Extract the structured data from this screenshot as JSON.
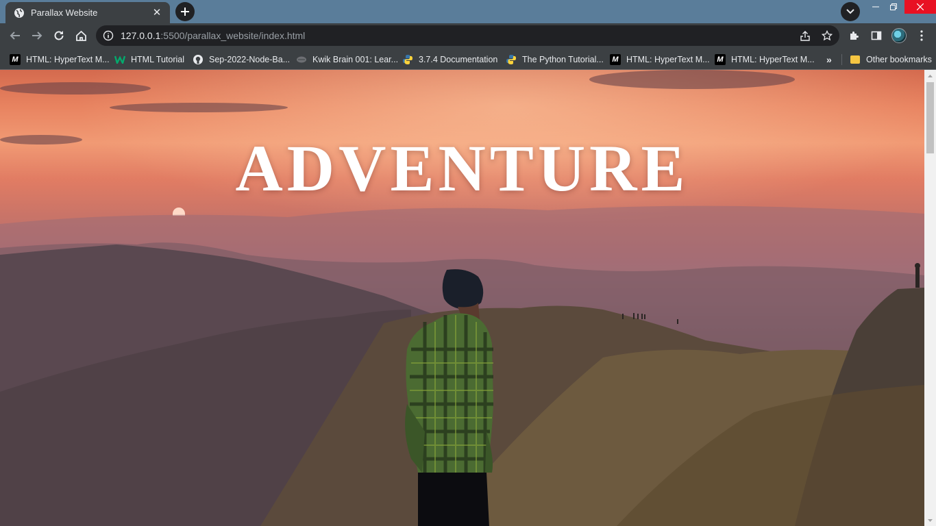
{
  "tab": {
    "title": "Parallax Website",
    "close_label": "✕"
  },
  "newtab": {
    "label": "+"
  },
  "address": {
    "host": "127.0.0.1",
    "rest": ":5500/parallax_website/index.html"
  },
  "bookmarks": [
    {
      "icon": "mdn-icon",
      "label": "HTML: HyperText M..."
    },
    {
      "icon": "w3schools-icon",
      "label": "HTML Tutorial"
    },
    {
      "icon": "github-icon",
      "label": "Sep-2022-Node-Ba..."
    },
    {
      "icon": "kwik-icon",
      "label": "Kwik Brain 001: Lear..."
    },
    {
      "icon": "python-icon",
      "label": "3.7.4 Documentation"
    },
    {
      "icon": "python-icon",
      "label": "The Python Tutorial..."
    },
    {
      "icon": "mdn-icon",
      "label": "HTML: HyperText M..."
    },
    {
      "icon": "mdn-icon",
      "label": "HTML: HyperText M..."
    }
  ],
  "bookmarks_overflow": "»",
  "other_bookmarks": "Other bookmarks",
  "page": {
    "heading": "ADVENTURE"
  },
  "colors": {
    "tabstrip": "#5a7d9a",
    "toolbar": "#3c4043",
    "close": "#e81123"
  }
}
